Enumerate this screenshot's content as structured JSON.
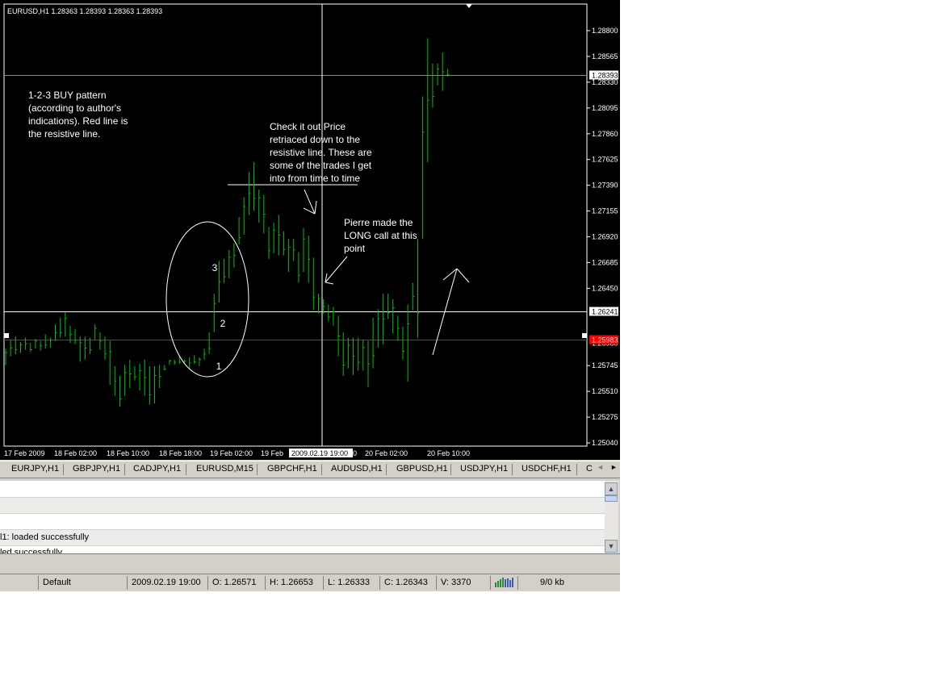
{
  "window": {
    "chart_title": "EURUSD,H1  1.28363 1.28393 1.28363 1.28393"
  },
  "colors": {
    "background": "#000000",
    "candle": "#00c000",
    "grid_lines": "#ffffff",
    "resistive_line": "#ff0000",
    "text": "#ffffff"
  },
  "chart_data": {
    "type": "bar",
    "symbol": "EURUSD",
    "timeframe": "H1",
    "ylim": [
      1.2504,
      1.289
    ],
    "price_ticks": [
      "1.28800",
      "1.28565",
      "1.28330",
      "1.28095",
      "1.27860",
      "1.27625",
      "1.27390",
      "1.27155",
      "1.26920",
      "1.26685",
      "1.26450",
      "1.26241",
      "1.25980",
      "1.25745",
      "1.25510",
      "1.25275",
      "1.25040"
    ],
    "current_price_label": "1.28393",
    "crosshair_price_label": "1.26241",
    "resistive_line_label": "1.25983",
    "time_labels": [
      "17 Feb 2009",
      "18 Feb 02:00",
      "18 Feb 10:00",
      "18 Feb 18:00",
      "19 Feb 02:00",
      "19 Feb",
      "2009.02.19 19:00",
      "0",
      "20 Feb 02:00",
      "20 Feb 10:00"
    ],
    "horizontal_lines": [
      {
        "name": "current-price",
        "value": 1.28393
      },
      {
        "name": "crosshair-price",
        "value": 1.26241
      },
      {
        "name": "resistive-line",
        "value": 1.25983
      }
    ],
    "bars_high_low": [
      [
        1.259,
        1.2575
      ],
      [
        1.2598,
        1.2583
      ],
      [
        1.2601,
        1.2585
      ],
      [
        1.2596,
        1.2586
      ],
      [
        1.26,
        1.2589
      ],
      [
        1.2595,
        1.2587
      ],
      [
        1.2599,
        1.259
      ],
      [
        1.2597,
        1.2588
      ],
      [
        1.2603,
        1.259
      ],
      [
        1.26,
        1.2591
      ],
      [
        1.2612,
        1.2597
      ],
      [
        1.2618,
        1.26
      ],
      [
        1.2623,
        1.2601
      ],
      [
        1.2611,
        1.2595
      ],
      [
        1.2608,
        1.2594
      ],
      [
        1.2601,
        1.2578
      ],
      [
        1.2601,
        1.258
      ],
      [
        1.26,
        1.2585
      ],
      [
        1.2612,
        1.2598
      ],
      [
        1.2605,
        1.2589
      ],
      [
        1.2601,
        1.258
      ],
      [
        1.2597,
        1.2557
      ],
      [
        1.2574,
        1.2547
      ],
      [
        1.2565,
        1.2537
      ],
      [
        1.2575,
        1.2547
      ],
      [
        1.258,
        1.2554
      ],
      [
        1.2574,
        1.2561
      ],
      [
        1.2576,
        1.2552
      ],
      [
        1.258,
        1.2547
      ],
      [
        1.2574,
        1.2539
      ],
      [
        1.2574,
        1.254
      ],
      [
        1.2575,
        1.2554
      ],
      [
        1.2575,
        1.257
      ],
      [
        1.258,
        1.2575
      ],
      [
        1.258,
        1.2575
      ],
      [
        1.2583,
        1.2576
      ],
      [
        1.258,
        1.2576
      ],
      [
        1.2582,
        1.2572
      ],
      [
        1.2584,
        1.2576
      ],
      [
        1.2582,
        1.2574
      ],
      [
        1.259,
        1.258
      ],
      [
        1.2605,
        1.2585
      ],
      [
        1.264,
        1.2605
      ],
      [
        1.267,
        1.2632
      ],
      [
        1.2672,
        1.265
      ],
      [
        1.268,
        1.2654
      ],
      [
        1.2686,
        1.2664
      ],
      [
        1.271,
        1.2685
      ],
      [
        1.2728,
        1.2694
      ],
      [
        1.2751,
        1.2712
      ],
      [
        1.276,
        1.2716
      ],
      [
        1.2735,
        1.2705
      ],
      [
        1.273,
        1.2695
      ],
      [
        1.2701,
        1.2672
      ],
      [
        1.2705,
        1.2677
      ],
      [
        1.2712,
        1.2675
      ],
      [
        1.2697,
        1.2675
      ],
      [
        1.269,
        1.266
      ],
      [
        1.269,
        1.267
      ],
      [
        1.2678,
        1.265
      ],
      [
        1.27,
        1.266
      ],
      [
        1.2693,
        1.265
      ],
      [
        1.2673,
        1.2625
      ],
      [
        1.264,
        1.2622
      ],
      [
        1.2635,
        1.2622
      ],
      [
        1.263,
        1.2615
      ],
      [
        1.2628,
        1.2611
      ],
      [
        1.262,
        1.2583
      ],
      [
        1.2605,
        1.2565
      ],
      [
        1.26,
        1.2572
      ],
      [
        1.26,
        1.2566
      ],
      [
        1.26,
        1.257
      ],
      [
        1.2598,
        1.257
      ],
      [
        1.2597,
        1.2555
      ],
      [
        1.2618,
        1.2572
      ],
      [
        1.2626,
        1.2591
      ],
      [
        1.264,
        1.2594
      ],
      [
        1.264,
        1.2617
      ],
      [
        1.2635,
        1.2604
      ],
      [
        1.262,
        1.2597
      ],
      [
        1.261,
        1.258
      ],
      [
        1.263,
        1.256
      ],
      [
        1.265,
        1.2625
      ],
      [
        1.269,
        1.26
      ],
      [
        1.282,
        1.269
      ],
      [
        1.2873,
        1.276
      ],
      [
        1.285,
        1.281
      ],
      [
        1.285,
        1.283
      ],
      [
        1.286,
        1.2825
      ],
      [
        1.2845,
        1.2838
      ]
    ]
  },
  "annotations": {
    "pattern_note": [
      "1-2-3 BUY pattern",
      "(according to author's",
      "indications).  Red line is",
      "the resistive line."
    ],
    "retrace_note": [
      "Check it out Price",
      "retriaced down to the",
      "resistive line. These are",
      "some of the trades I get",
      "into from time to time"
    ],
    "pierre_note": [
      "Pierre made the",
      "LONG call at this",
      "point"
    ],
    "point_1": "1",
    "point_2": "2",
    "point_3": "3"
  },
  "tabs": [
    "EURJPY,H1",
    "GBPJPY,H1",
    "CADJPY,H1",
    "EURUSD,M15",
    "GBPCHF,H1",
    "AUDUSD,H1",
    "GBPUSD,H1",
    "USDJPY,H1",
    "USDCHF,H1",
    "C"
  ],
  "tab_scroll_left": "◄",
  "tab_scroll_right": "►",
  "terminal": {
    "row1": "",
    "row2": "",
    "row3": "l1: loaded successfully",
    "row4": "led successfully"
  },
  "scrollbar": {
    "up": "▲",
    "down": "▼"
  },
  "status_bar": {
    "profile": "Default",
    "datetime": "2009.02.19 19:00",
    "open": "O: 1.26571",
    "high": "H: 1.26653",
    "low": "L: 1.26333",
    "close": "C: 1.26343",
    "volume": "V: 3370",
    "traffic": "9/0 kb"
  }
}
